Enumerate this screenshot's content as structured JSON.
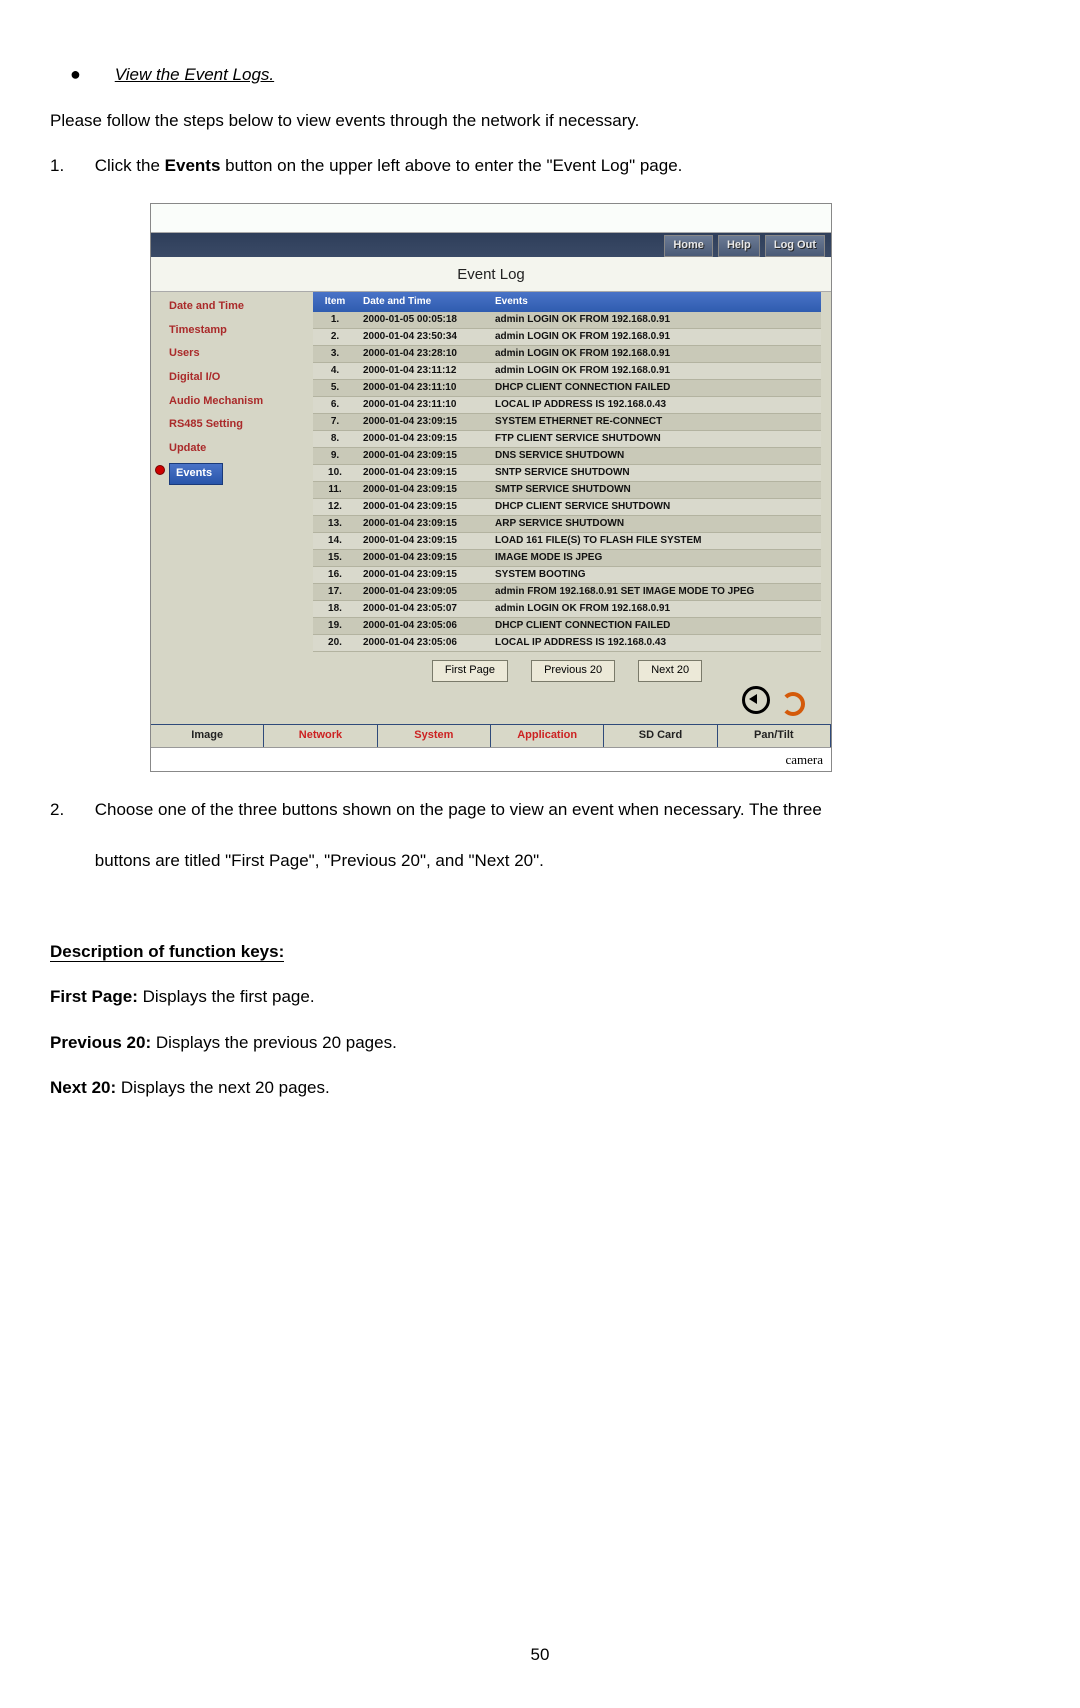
{
  "doc": {
    "bullet_title": "View the Event Logs.",
    "intro": "Please follow the steps below to view events through the network if necessary.",
    "step1_num": "1.",
    "step1_a": "Click the ",
    "step1_b_bold": "Events",
    "step1_c": " button on the upper left above to enter the \"Event Log\" page.",
    "step2_num": "2.",
    "step2_line1": "Choose one of the three buttons shown on the page to view an event when necessary. The three",
    "step2_line2": "buttons are titled \"First Page\", \"Previous 20\", and \"Next 20\".",
    "desc_heading": "Description of function keys:",
    "fk1_b": "First Page:",
    "fk1_t": " Displays the first page.",
    "fk2_b": "Previous 20:",
    "fk2_t": " Displays the previous 20 pages.",
    "fk3_b": "Next 20:",
    "fk3_t": " Displays the next 20 pages.",
    "page_number": "50"
  },
  "ui": {
    "nav": {
      "home": "Home",
      "help": "Help",
      "logout": "Log Out"
    },
    "title": "Event Log",
    "side": {
      "date_time": "Date and Time",
      "timestamp": "Timestamp",
      "users": "Users",
      "digital_io": "Digital I/O",
      "audio": "Audio Mechanism",
      "rs485": "RS485 Setting",
      "update": "Update",
      "events": "Events"
    },
    "thead": {
      "item": "Item",
      "dt": "Date and Time",
      "ev": "Events"
    },
    "rows": [
      {
        "n": "1.",
        "dt": "2000-01-05 00:05:18",
        "ev": "admin LOGIN OK FROM 192.168.0.91"
      },
      {
        "n": "2.",
        "dt": "2000-01-04 23:50:34",
        "ev": "admin LOGIN OK FROM 192.168.0.91"
      },
      {
        "n": "3.",
        "dt": "2000-01-04 23:28:10",
        "ev": "admin LOGIN OK FROM 192.168.0.91"
      },
      {
        "n": "4.",
        "dt": "2000-01-04 23:11:12",
        "ev": "admin LOGIN OK FROM 192.168.0.91"
      },
      {
        "n": "5.",
        "dt": "2000-01-04 23:11:10",
        "ev": "DHCP CLIENT CONNECTION FAILED"
      },
      {
        "n": "6.",
        "dt": "2000-01-04 23:11:10",
        "ev": "LOCAL IP ADDRESS IS 192.168.0.43"
      },
      {
        "n": "7.",
        "dt": "2000-01-04 23:09:15",
        "ev": "SYSTEM ETHERNET RE-CONNECT"
      },
      {
        "n": "8.",
        "dt": "2000-01-04 23:09:15",
        "ev": "FTP CLIENT SERVICE SHUTDOWN"
      },
      {
        "n": "9.",
        "dt": "2000-01-04 23:09:15",
        "ev": "DNS SERVICE SHUTDOWN"
      },
      {
        "n": "10.",
        "dt": "2000-01-04 23:09:15",
        "ev": "SNTP SERVICE SHUTDOWN"
      },
      {
        "n": "11.",
        "dt": "2000-01-04 23:09:15",
        "ev": "SMTP SERVICE SHUTDOWN"
      },
      {
        "n": "12.",
        "dt": "2000-01-04 23:09:15",
        "ev": "DHCP CLIENT SERVICE SHUTDOWN"
      },
      {
        "n": "13.",
        "dt": "2000-01-04 23:09:15",
        "ev": "ARP SERVICE SHUTDOWN"
      },
      {
        "n": "14.",
        "dt": "2000-01-04 23:09:15",
        "ev": "LOAD 161 FILE(S) TO FLASH FILE SYSTEM"
      },
      {
        "n": "15.",
        "dt": "2000-01-04 23:09:15",
        "ev": "IMAGE MODE IS JPEG"
      },
      {
        "n": "16.",
        "dt": "2000-01-04 23:09:15",
        "ev": "SYSTEM BOOTING"
      },
      {
        "n": "17.",
        "dt": "2000-01-04 23:09:05",
        "ev": "admin FROM 192.168.0.91 SET IMAGE MODE TO JPEG"
      },
      {
        "n": "18.",
        "dt": "2000-01-04 23:05:07",
        "ev": "admin LOGIN OK FROM 192.168.0.91"
      },
      {
        "n": "19.",
        "dt": "2000-01-04 23:05:06",
        "ev": "DHCP CLIENT CONNECTION FAILED"
      },
      {
        "n": "20.",
        "dt": "2000-01-04 23:05:06",
        "ev": "LOCAL IP ADDRESS IS 192.168.0.43"
      }
    ],
    "pager": {
      "first": "First Page",
      "prev": "Previous 20",
      "next": "Next 20"
    },
    "tabs": {
      "image": "Image",
      "network": "Network",
      "system": "System",
      "application": "Application",
      "sdcard": "SD Card",
      "pantilt": "Pan/Tilt"
    },
    "footer": "camera"
  }
}
